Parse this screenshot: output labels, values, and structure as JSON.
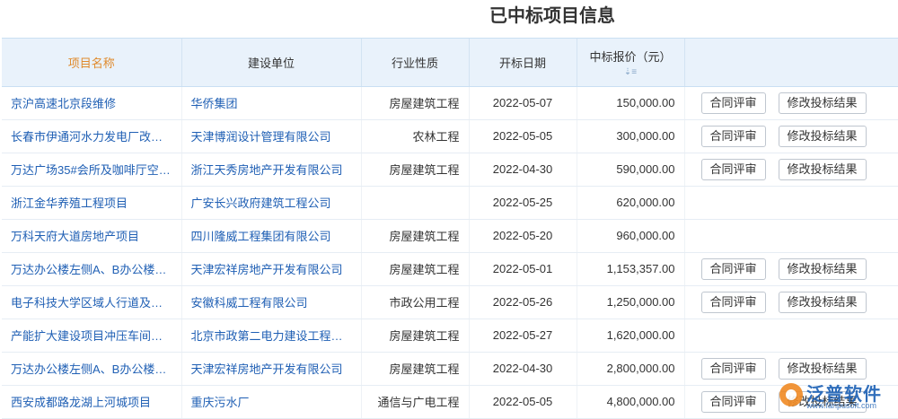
{
  "page": {
    "title": "已中标项目信息"
  },
  "table": {
    "headers": {
      "name": "项目名称",
      "unit": "建设单位",
      "industry": "行业性质",
      "date": "开标日期",
      "price": "中标报价（元）",
      "ops": ""
    },
    "actions": {
      "review": "合同评审",
      "modify": "修改投标结果"
    },
    "rows": [
      {
        "name": "京沪高速北京段维修",
        "unit": "华侨集团",
        "industry": "房屋建筑工程",
        "date": "2022-05-07",
        "price": "150,000.00",
        "actions": true
      },
      {
        "name": "长春市伊通河水力发电厂改…",
        "unit": "天津博润设计管理有限公司",
        "industry": "农林工程",
        "date": "2022-05-05",
        "price": "300,000.00",
        "actions": true
      },
      {
        "name": "万达广场35#会所及咖啡厅空…",
        "unit": "浙江天秀房地产开发有限公司",
        "industry": "房屋建筑工程",
        "date": "2022-04-30",
        "price": "590,000.00",
        "actions": true
      },
      {
        "name": "浙江金华养殖工程项目",
        "unit": "广安长兴政府建筑工程公司",
        "industry": "",
        "date": "2022-05-25",
        "price": "620,000.00",
        "actions": false
      },
      {
        "name": "万科天府大道房地产项目",
        "unit": "四川隆威工程集团有限公司",
        "industry": "房屋建筑工程",
        "date": "2022-05-20",
        "price": "960,000.00",
        "actions": false
      },
      {
        "name": "万达办公楼左侧A、B办公楼…",
        "unit": "天津宏祥房地产开发有限公司",
        "industry": "房屋建筑工程",
        "date": "2022-05-01",
        "price": "1,153,357.00",
        "actions": true
      },
      {
        "name": "电子科技大学区域人行道及…",
        "unit": "安徽科威工程有限公司",
        "industry": "市政公用工程",
        "date": "2022-05-26",
        "price": "1,250,000.00",
        "actions": true
      },
      {
        "name": "产能扩大建设项目冲压车间…",
        "unit": "北京市政第二电力建设工程…",
        "industry": "房屋建筑工程",
        "date": "2022-05-27",
        "price": "1,620,000.00",
        "actions": false
      },
      {
        "name": "万达办公楼左侧A、B办公楼…",
        "unit": "天津宏祥房地产开发有限公司",
        "industry": "房屋建筑工程",
        "date": "2022-04-30",
        "price": "2,800,000.00",
        "actions": true
      },
      {
        "name": "西安成都路龙湖上河城项目",
        "unit": "重庆污水厂",
        "industry": "通信与广电工程",
        "date": "2022-05-05",
        "price": "4,800,000.00",
        "actions": true
      }
    ]
  },
  "watermark": {
    "brand": "泛普软件",
    "url": "www.fanpusoft.com"
  },
  "colors": {
    "header_bg": "#e9f2fb",
    "link": "#1f5fb4",
    "accent": "#e08a2c"
  }
}
